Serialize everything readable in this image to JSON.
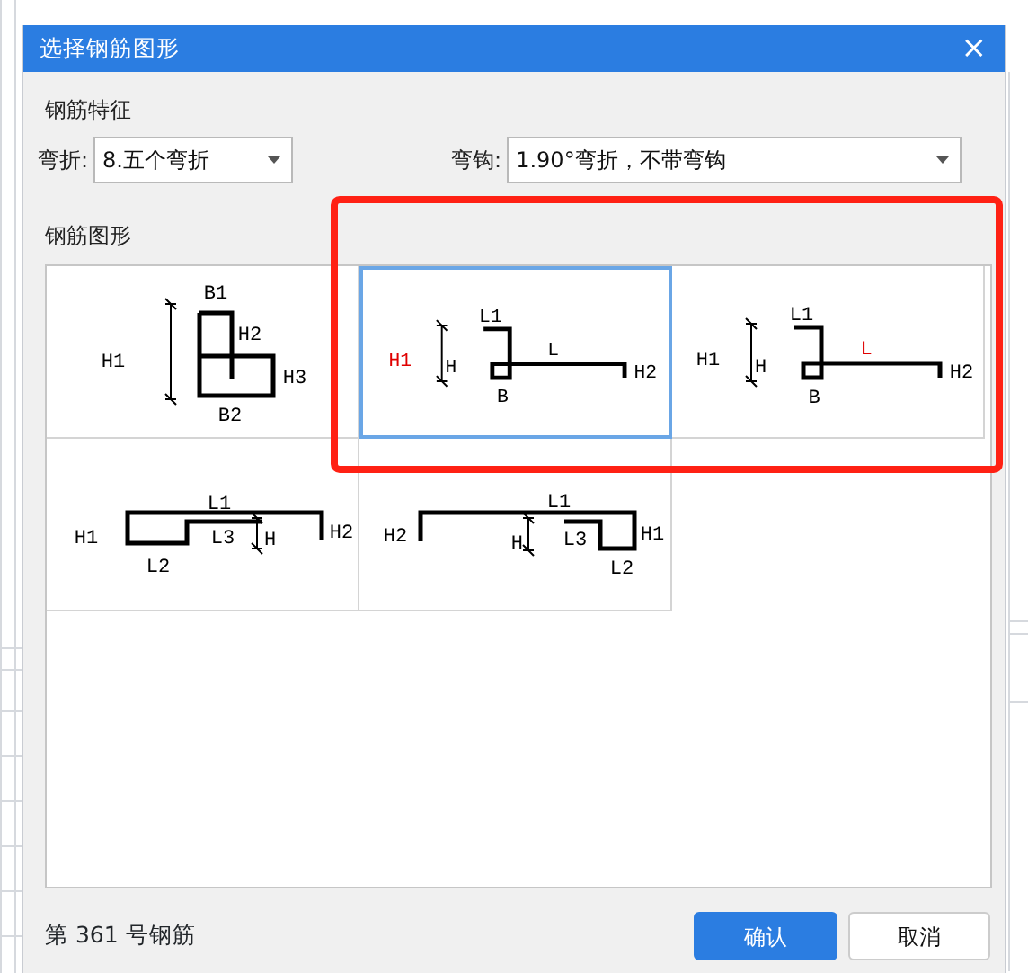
{
  "window": {
    "title": "选择钢筋图形",
    "close": "×"
  },
  "features": {
    "heading": "钢筋特征",
    "bend": {
      "label": "弯折:",
      "value": "8.五个弯折"
    },
    "hook": {
      "label": "弯钩:",
      "value": "1.90°弯折，不带弯钩"
    }
  },
  "shapes_heading": "钢筋图形",
  "shapes": [
    {
      "kind": "frame",
      "selected": false,
      "labels": [
        {
          "text": "H1",
          "highlighted": false
        },
        {
          "text": "B1",
          "highlighted": false
        },
        {
          "text": "H2",
          "highlighted": false
        },
        {
          "text": "H3",
          "highlighted": false
        },
        {
          "text": "B2",
          "highlighted": false
        }
      ]
    },
    {
      "kind": "hook",
      "selected": true,
      "labels": [
        {
          "text": "H1",
          "highlighted": true
        },
        {
          "text": "H",
          "highlighted": false
        },
        {
          "text": "L1",
          "highlighted": false
        },
        {
          "text": "L",
          "highlighted": false
        },
        {
          "text": "H2",
          "highlighted": false
        },
        {
          "text": "B",
          "highlighted": false
        }
      ]
    },
    {
      "kind": "hook",
      "selected": false,
      "labels": [
        {
          "text": "H1",
          "highlighted": false
        },
        {
          "text": "H",
          "highlighted": false
        },
        {
          "text": "L1",
          "highlighted": false
        },
        {
          "text": "L",
          "highlighted": true
        },
        {
          "text": "H2",
          "highlighted": false
        },
        {
          "text": "B",
          "highlighted": false
        }
      ]
    },
    {
      "kind": "step-left",
      "selected": false,
      "labels": [
        {
          "text": "L1",
          "highlighted": false
        },
        {
          "text": "H1",
          "highlighted": false
        },
        {
          "text": "L3",
          "highlighted": false
        },
        {
          "text": "H",
          "highlighted": false
        },
        {
          "text": "H2",
          "highlighted": false
        },
        {
          "text": "L2",
          "highlighted": false
        }
      ]
    },
    {
      "kind": "step-right",
      "selected": false,
      "labels": [
        {
          "text": "L1",
          "highlighted": false
        },
        {
          "text": "H2",
          "highlighted": false
        },
        {
          "text": "H",
          "highlighted": false
        },
        {
          "text": "L3",
          "highlighted": false
        },
        {
          "text": "H1",
          "highlighted": false
        },
        {
          "text": "L2",
          "highlighted": false
        }
      ]
    }
  ],
  "status": "第 361 号钢筋",
  "buttons": [
    {
      "kind": "primary",
      "label": "确认"
    },
    {
      "kind": "secondary",
      "label": "取消"
    }
  ],
  "highlight_frame": true
}
